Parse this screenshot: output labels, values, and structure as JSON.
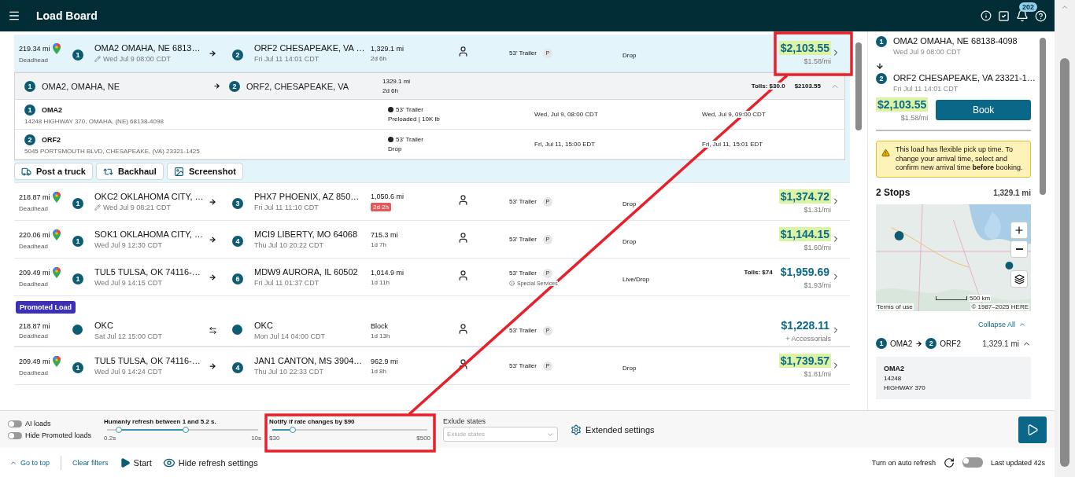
{
  "header": {
    "title": "Load Board",
    "notification_count": "202"
  },
  "loads": [
    {
      "kind": "standard",
      "selected": true,
      "expanded": true,
      "deadhead": "219.34 mi",
      "deadhead_label": "Deadhead",
      "origin_stop": "1",
      "origin": "OMA2 OMAHA, NE 6813…",
      "origin_time": "Wed Jul 9 08:00 CDT",
      "origin_edited": true,
      "dest_stop": "2",
      "dest": "ORF2 CHESAPEAKE, VA …",
      "dest_time": "Fri Jul 11 14:01 CDT",
      "miles": "1,329.1 mi",
      "duration": "2d 6h",
      "duration_alert": false,
      "trailer": "53' Trailer",
      "trailer_badge": "P",
      "load_type": "Drop",
      "price": "$2,103.55",
      "price_highlight": true,
      "rate": "$1.58/mi",
      "detail": {
        "origin_stop": "1",
        "origin": "OMA2, OMAHA, NE",
        "dest_stop": "2",
        "dest": "ORF2, CHESAPEAKE, VA",
        "miles": "1329.1 mi",
        "duration": "2d 6h",
        "tolls": "Tolls: $30.0",
        "price": "$2103.55",
        "stops": [
          {
            "number": "1",
            "name": "OMA2",
            "address": "14248 HIGHWAY 370, OMAHA, (NE) 68138-4098",
            "equipment": "53' Trailer",
            "note": "Preloaded | 10K lb",
            "arrival": "Wed, Jul 9, 08:00 CDT",
            "departure": "Wed, Jul 9, 09:00 CDT"
          },
          {
            "number": "2",
            "name": "ORF2",
            "address": "5045 PORTSMOUTH BLVD, CHESAPEAKE, (VA) 23321-1425",
            "equipment": "53' Trailer",
            "note": "Drop",
            "arrival": "Fri, Jul 11, 15:00 EDT",
            "departure": "Fri, Jul 11, 15:01 EDT"
          }
        ],
        "actions": [
          {
            "kind": "truck",
            "label": "Post a truck"
          },
          {
            "kind": "backhaul",
            "label": "Backhaul"
          },
          {
            "kind": "screenshot",
            "label": "Screenshot"
          }
        ]
      }
    },
    {
      "kind": "standard",
      "selected": false,
      "expanded": false,
      "deadhead": "218.87 mi",
      "deadhead_label": "Deadhead",
      "origin_stop": "1",
      "origin": "OKC2 OKLAHOMA CITY, …",
      "origin_time": "Wed Jul 9 08:21 CDT",
      "origin_edited": true,
      "dest_stop": "3",
      "dest": "PHX7 PHOENIX, AZ 850…",
      "dest_time": "Fri Jul 11 11:10 CDT",
      "miles": "1,050.6 mi",
      "duration": "2d 2h",
      "duration_alert": true,
      "trailer": "53' Trailer",
      "trailer_badge": "P",
      "load_type": "Drop",
      "price": "$1,374.72",
      "price_highlight": true,
      "rate": "$1.31/mi"
    },
    {
      "kind": "standard",
      "selected": false,
      "expanded": false,
      "deadhead": "220.06 mi",
      "deadhead_label": "Deadhead",
      "origin_stop": "1",
      "origin": "SOK1 OKLAHOMA CITY, …",
      "origin_time": "Wed Jul 9 12:30 CDT",
      "origin_edited": false,
      "dest_stop": "4",
      "dest": "MCI9 LIBERTY, MO 64068",
      "dest_time": "Thu Jul 10 20:22 CDT",
      "miles": "715.3 mi",
      "duration": "1d 7h",
      "duration_alert": false,
      "trailer": "53' Trailer",
      "trailer_badge": "P",
      "load_type": "Drop",
      "price": "$1,144.15",
      "price_highlight": true,
      "rate": "$1.60/mi"
    },
    {
      "kind": "standard",
      "selected": false,
      "expanded": false,
      "deadhead": "209.49 mi",
      "deadhead_label": "Deadhead",
      "origin_stop": "1",
      "origin": "TUL5 TULSA, OK 74116-…",
      "origin_time": "Wed Jul 9 14:15 CDT",
      "origin_edited": false,
      "dest_stop": "6",
      "dest": "MDW9 AURORA, IL 60502",
      "dest_time": "Fri Jul 11 01:37 CDT",
      "miles": "1,014.9 mi",
      "duration": "1d 11h",
      "duration_alert": false,
      "trailer": "53' Trailer",
      "trailer_badge": "P",
      "special": "Special Services",
      "load_type": "Live/Drop",
      "tolls": "Tolls: $74",
      "price": "$1,959.69",
      "price_highlight": false,
      "rate": "$1.93/mi"
    },
    {
      "kind": "promoted",
      "badge": "Promoted Load",
      "selected": false,
      "expanded": false,
      "deadhead": "218.87 mi",
      "deadhead_label": "Deadhead",
      "origin": "OKC",
      "origin_time": "Sat Jul 12 15:00 CDT",
      "origin_edited": false,
      "dest": "OKC",
      "dest_time": "Mon Jul 14 04:00 CDT",
      "miles": "Block",
      "duration": "1d 13h",
      "duration_alert": false,
      "trailer": "53' Trailer",
      "trailer_badge": "P",
      "price": "$1,228.11",
      "price_highlight": false,
      "rate": "+ Accessorials"
    },
    {
      "kind": "standard",
      "selected": false,
      "expanded": false,
      "deadhead": "209.49 mi",
      "deadhead_label": "Deadhead",
      "origin_stop": "1",
      "origin": "TUL5 TULSA, OK 74116-…",
      "origin_time": "Wed Jul 9 14:24 CDT",
      "origin_edited": false,
      "dest_stop": "4",
      "dest": "JAN1 CANTON, MS 3904…",
      "dest_time": "Thu Jul 10 22:33 CDT",
      "miles": "962.9 mi",
      "duration": "1d 8h",
      "duration_alert": false,
      "trailer": "53' Trailer",
      "trailer_badge": "P",
      "load_type": "Drop",
      "price": "$1,739.57",
      "price_highlight": true,
      "rate": "$1.81/mi"
    }
  ],
  "panel": {
    "origin_stop": "1",
    "origin": "OMA2 OMAHA, NE 68138-4098",
    "origin_time": "Wed Jul 9 08:00 CDT",
    "dest_stop": "2",
    "dest": "ORF2 CHESAPEAKE, VA 23321-1…",
    "dest_time": "Fri Jul 11 14:01 CDT",
    "price": "$2,103.55",
    "rate": "$1.58/mi",
    "book": "Book",
    "notice": "This load has flexible pick up time. To change your arrival time, select and confirm new arrival time **before** booking.",
    "stops_title": "2 Stops",
    "stops_miles": "1,329.1 mi",
    "map": {
      "kind": "picture",
      "scale": "500 km",
      "terms": "Terms of use",
      "copyright": "© 1987–2025 HERE"
    },
    "collapse_all": "Collapse All",
    "route": {
      "origin_stop": "1",
      "origin": "OMA2",
      "dest_stop": "2",
      "dest": "ORF2",
      "miles": "1,329.1 mi",
      "expanded": true,
      "stop_name": "OMA2",
      "address_lines": [
        "14248",
        "HIGHWAY 370"
      ]
    }
  },
  "settings": {
    "toggles": [
      {
        "label": "AI loads",
        "on": false
      },
      {
        "label": "Hide Promoted loads",
        "on": false
      }
    ],
    "refresh": {
      "label": "Humanly refresh between 1 and 5.2 s.",
      "thumbs": [
        {
          "level": 0.08
        },
        {
          "level": 0.52
        }
      ],
      "min": "0.2s",
      "max": "10s"
    },
    "notify": {
      "label": "Notify if rate changes by $90",
      "level": 0.13,
      "min": "$30",
      "max": "$500"
    },
    "exclude": {
      "label": "Exlude states",
      "placeholder": "Exlude states"
    },
    "extended": "Extended settings"
  },
  "footer": {
    "go_top": "Go to top",
    "clear_filters": "Clear filters",
    "start": "Start",
    "hide_settings": "Hide refresh settings",
    "auto_refresh": "Turn on auto refresh",
    "auto_refresh_on": false,
    "last_updated": "Last updated 42s"
  },
  "annotation": {
    "kind": "callout"
  }
}
